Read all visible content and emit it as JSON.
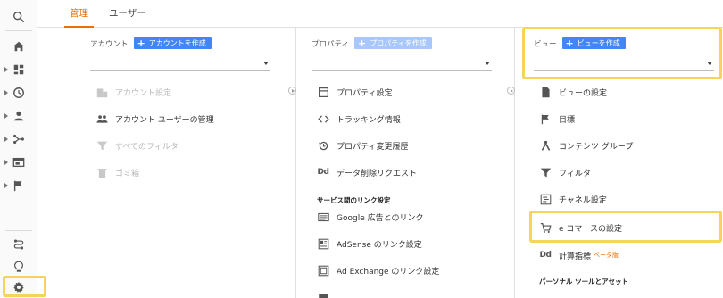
{
  "tabs": [
    {
      "label": "管理",
      "active": true
    },
    {
      "label": "ユーザー",
      "active": false
    }
  ],
  "account": {
    "label": "アカウント",
    "create_label": "アカウントを作成",
    "items": [
      {
        "label": "アカウント設定",
        "icon": "building-icon",
        "disabled": true
      },
      {
        "label": "アカウント ユーザーの管理",
        "icon": "people-icon",
        "disabled": false
      },
      {
        "label": "すべてのフィルタ",
        "icon": "filter-icon",
        "disabled": true
      },
      {
        "label": "ゴミ箱",
        "icon": "trash-icon",
        "disabled": true
      }
    ]
  },
  "property": {
    "label": "プロパティ",
    "create_label": "プロパティを作成",
    "items": [
      {
        "label": "プロパティ設定",
        "icon": "settings-box-icon"
      },
      {
        "label": "トラッキング情報",
        "icon": "code-icon"
      },
      {
        "label": "プロパティ変更履歴",
        "icon": "history-icon"
      },
      {
        "label": "データ削除リクエスト",
        "icon": "dd-icon",
        "icon_text": "Dd"
      }
    ],
    "section_title": "サービス間のリンク設定",
    "links": [
      {
        "label": "Google 広告とのリンク",
        "icon": "ads-icon"
      },
      {
        "label": "AdSense のリンク設定",
        "icon": "adsense-icon"
      },
      {
        "label": "Ad Exchange のリンク設定",
        "icon": "adexchange-icon"
      }
    ]
  },
  "view": {
    "label": "ビュー",
    "create_label": "ビューを作成",
    "items": [
      {
        "label": "ビューの設定",
        "icon": "document-icon"
      },
      {
        "label": "目標",
        "icon": "flag-icon"
      },
      {
        "label": "コンテンツ グループ",
        "icon": "content-group-icon"
      },
      {
        "label": "フィルタ",
        "icon": "filter-icon"
      },
      {
        "label": "チャネル設定",
        "icon": "channel-icon"
      },
      {
        "label": "e コマースの設定",
        "icon": "cart-icon"
      },
      {
        "label": "計算指標",
        "icon": "dd-icon",
        "icon_text": "Dd",
        "badge": "ベータ版"
      }
    ],
    "section_title": "パーソナル ツールとアセット"
  },
  "sidebar": {
    "items": [
      "search-icon",
      "home-icon",
      "dashboard-icon",
      "clock-icon",
      "person-icon",
      "acquisition-icon",
      "behavior-icon",
      "flag-icon",
      "attribution-icon",
      "lightbulb-icon",
      "admin-gear-icon"
    ]
  },
  "colors": {
    "accent": "#e8710a",
    "button": "#4285f4",
    "highlight": "#f6d45b"
  }
}
